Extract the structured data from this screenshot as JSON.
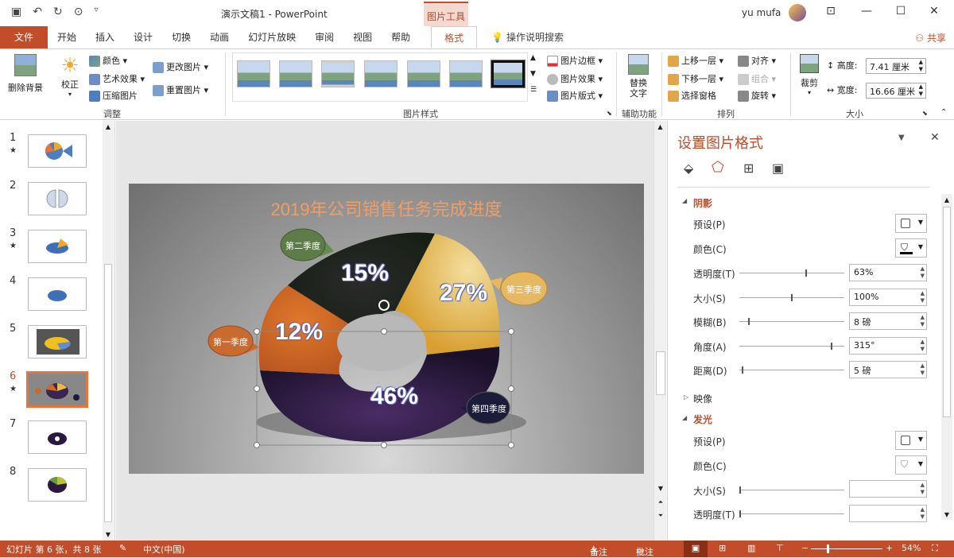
{
  "titlebar": {
    "title": "演示文稿1 - PowerPoint",
    "context_tab": "图片工具",
    "user": "yu mufa"
  },
  "tabs": [
    "文件",
    "开始",
    "插入",
    "设计",
    "切换",
    "动画",
    "幻灯片放映",
    "审阅",
    "视图",
    "帮助",
    "格式"
  ],
  "search_label": "操作说明搜索",
  "share_label": "共享",
  "ribbon": {
    "remove_bg": "删除背景",
    "correct": "校正",
    "color": "颜色",
    "art_effect": "艺术效果",
    "compress": "压缩图片",
    "change_pic": "更改图片",
    "reset_pic": "重置图片",
    "group_adjust": "调整",
    "pic_border": "图片边框",
    "pic_effect": "图片效果",
    "pic_layout": "图片版式",
    "group_styles": "图片样式",
    "alt_text": "替换文字",
    "group_access": "辅助功能",
    "bring_forward": "上移一层",
    "send_backward": "下移一层",
    "selection_pane": "选择窗格",
    "align": "对齐",
    "group": "组合",
    "rotate": "旋转",
    "group_arrange": "排列",
    "crop": "裁剪",
    "height_label": "高度:",
    "height_value": "7.41 厘米",
    "width_label": "宽度:",
    "width_value": "16.66 厘米",
    "group_size": "大小"
  },
  "thumbs": [
    {
      "num": "1",
      "star": "★"
    },
    {
      "num": "2",
      "star": ""
    },
    {
      "num": "3",
      "star": "★"
    },
    {
      "num": "4",
      "star": ""
    },
    {
      "num": "5",
      "star": ""
    },
    {
      "num": "6",
      "star": "★"
    },
    {
      "num": "7",
      "star": ""
    },
    {
      "num": "8",
      "star": ""
    }
  ],
  "slide": {
    "title": "2019年公司销售任务完成进度",
    "q1_label": "第一季度",
    "q1_pct": "12%",
    "q2_label": "第二季度",
    "q2_pct": "15%",
    "q3_label": "第三季度",
    "q3_pct": "27%",
    "q4_label": "第四季度",
    "q4_pct": "46%"
  },
  "format_pane": {
    "title": "设置图片格式",
    "shadow": "阴影",
    "preset": "预设(P)",
    "color": "颜色(C)",
    "transparency": "透明度(T)",
    "transparency_value": "63%",
    "size": "大小(S)",
    "size_value": "100%",
    "blur": "模糊(B)",
    "blur_value": "8 磅",
    "angle": "角度(A)",
    "angle_value": "315°",
    "distance": "距离(D)",
    "distance_value": "5 磅",
    "reflection": "映像",
    "glow": "发光",
    "glow_preset": "预设(P)",
    "glow_color": "颜色(C)",
    "glow_size": "大小(S)",
    "glow_transparency": "透明度(T)"
  },
  "status": {
    "slide_info": "幻灯片 第 6 张，共 8 张",
    "language": "中文(中国)",
    "notes": "备注",
    "comments": "批注",
    "zoom": "54%"
  }
}
